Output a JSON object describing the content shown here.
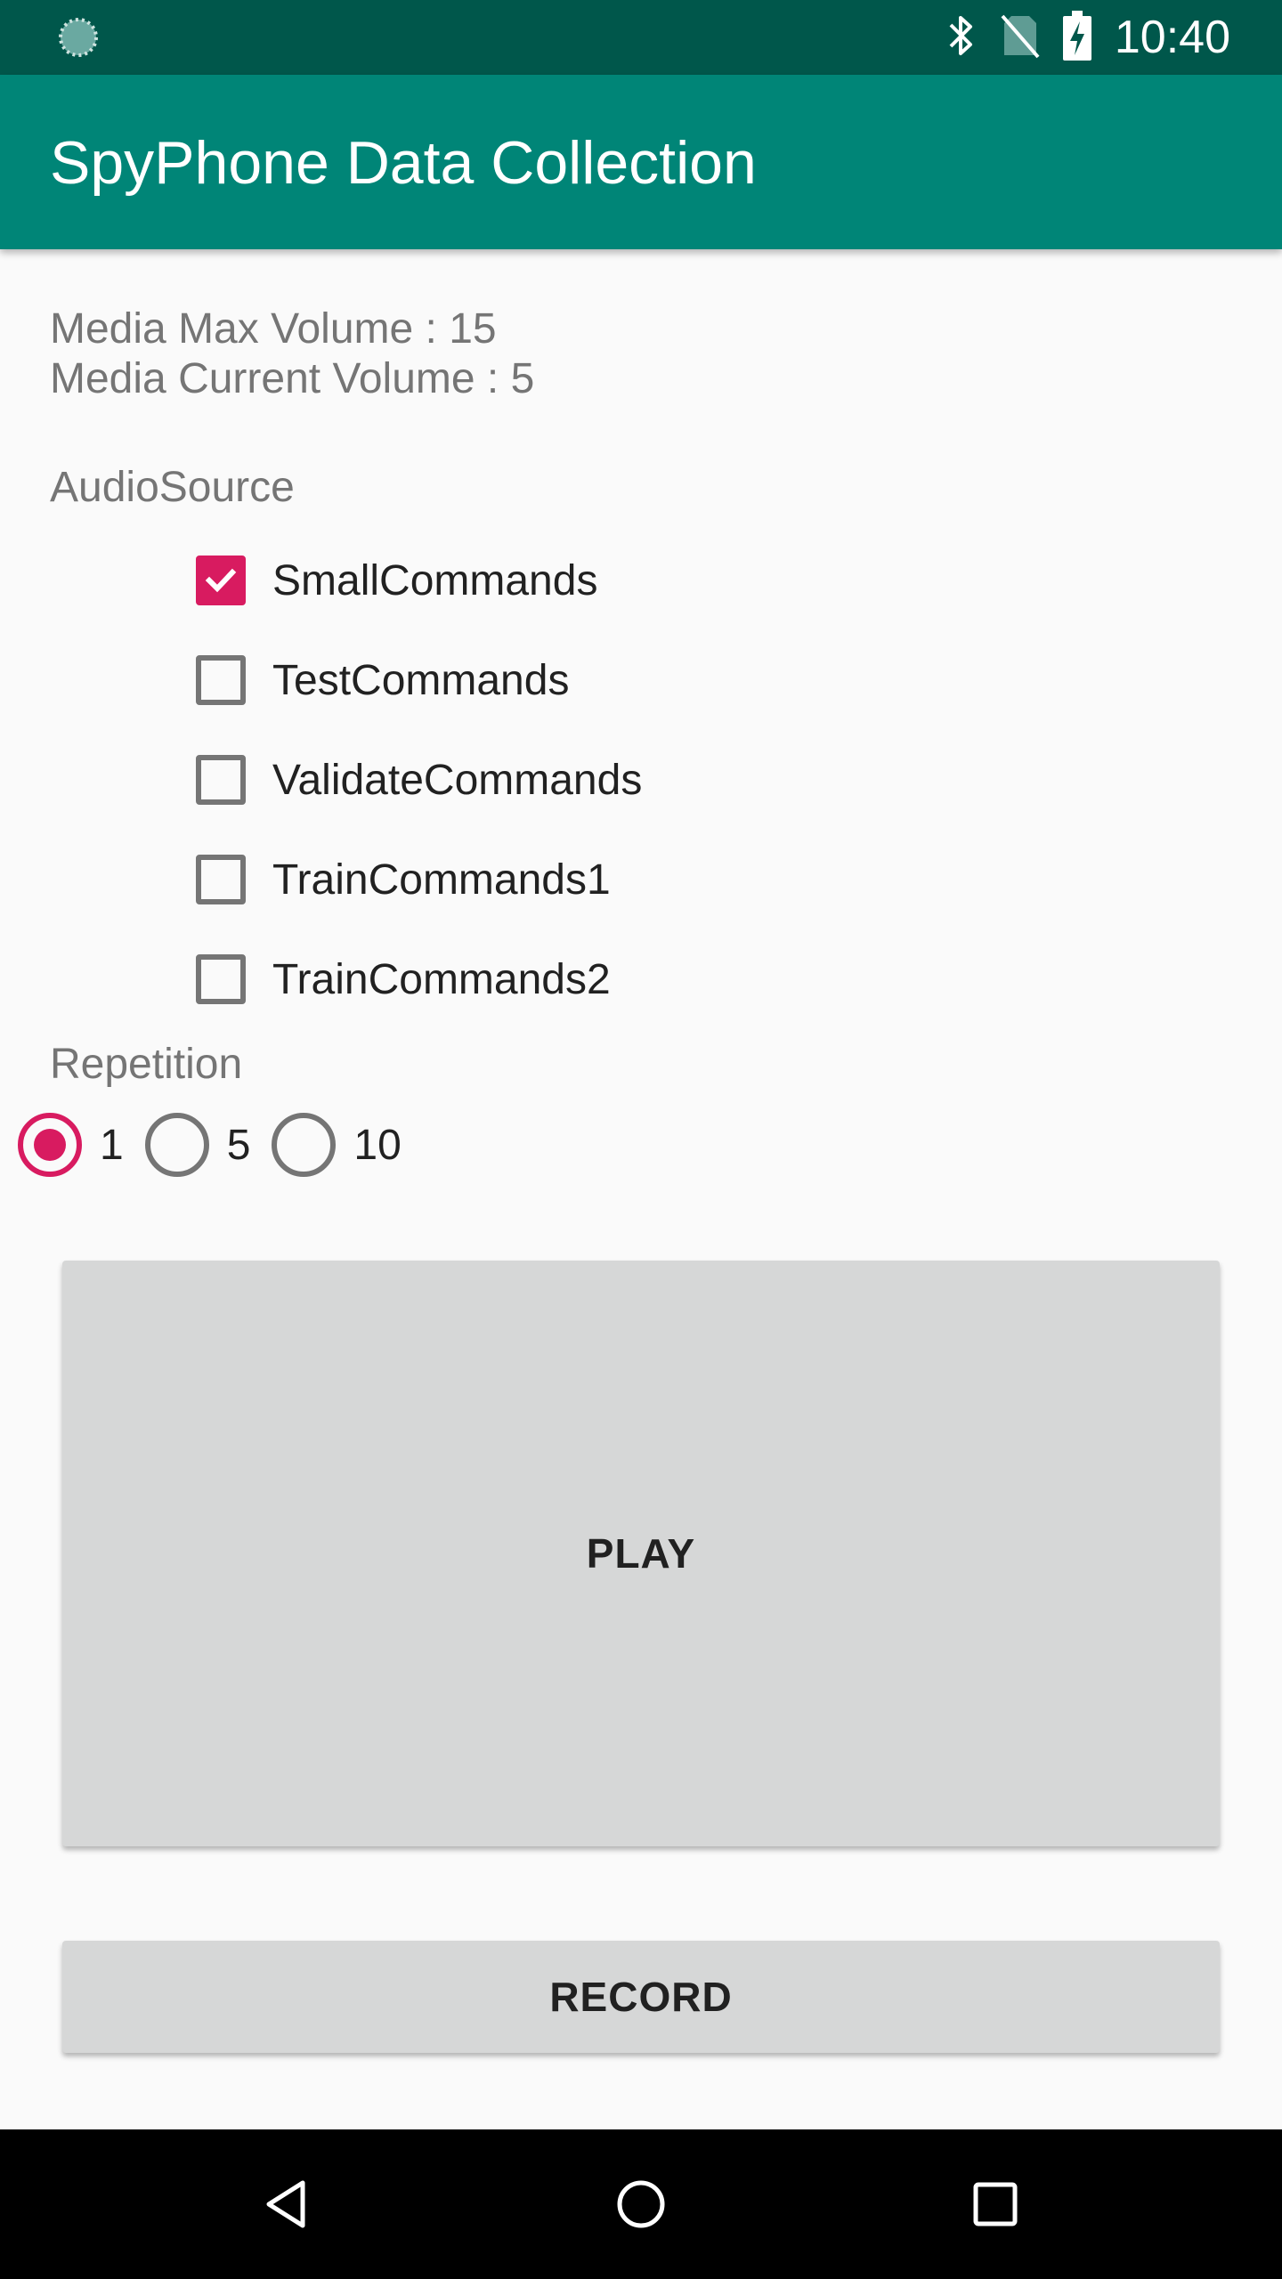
{
  "status_bar": {
    "time": "10:40",
    "icons": [
      "loading-spinner-icon",
      "bluetooth-icon",
      "no-sim-icon",
      "battery-charging-icon"
    ]
  },
  "app_bar": {
    "title": "SpyPhone Data Collection",
    "color": "#008577"
  },
  "media": {
    "max_volume_text": "Media Max Volume : 15",
    "current_volume_text": "Media Current Volume : 5"
  },
  "audio_source": {
    "label": "AudioSource",
    "options": [
      {
        "label": "SmallCommands",
        "checked": true
      },
      {
        "label": "TestCommands",
        "checked": false
      },
      {
        "label": "ValidateCommands",
        "checked": false
      },
      {
        "label": "TrainCommands1",
        "checked": false
      },
      {
        "label": "TrainCommands2",
        "checked": false
      }
    ]
  },
  "repetition": {
    "label": "Repetition",
    "options": [
      {
        "label": "1",
        "selected": true
      },
      {
        "label": "5",
        "selected": false
      },
      {
        "label": "10",
        "selected": false
      }
    ]
  },
  "buttons": {
    "play_label": "PLAY",
    "record_label": "RECORD"
  },
  "nav_bar": {
    "icons": [
      "back-icon",
      "home-icon",
      "recents-icon"
    ]
  },
  "colors": {
    "accent": "#d81b60",
    "primary": "#008577",
    "primary_dark": "#00574b"
  }
}
